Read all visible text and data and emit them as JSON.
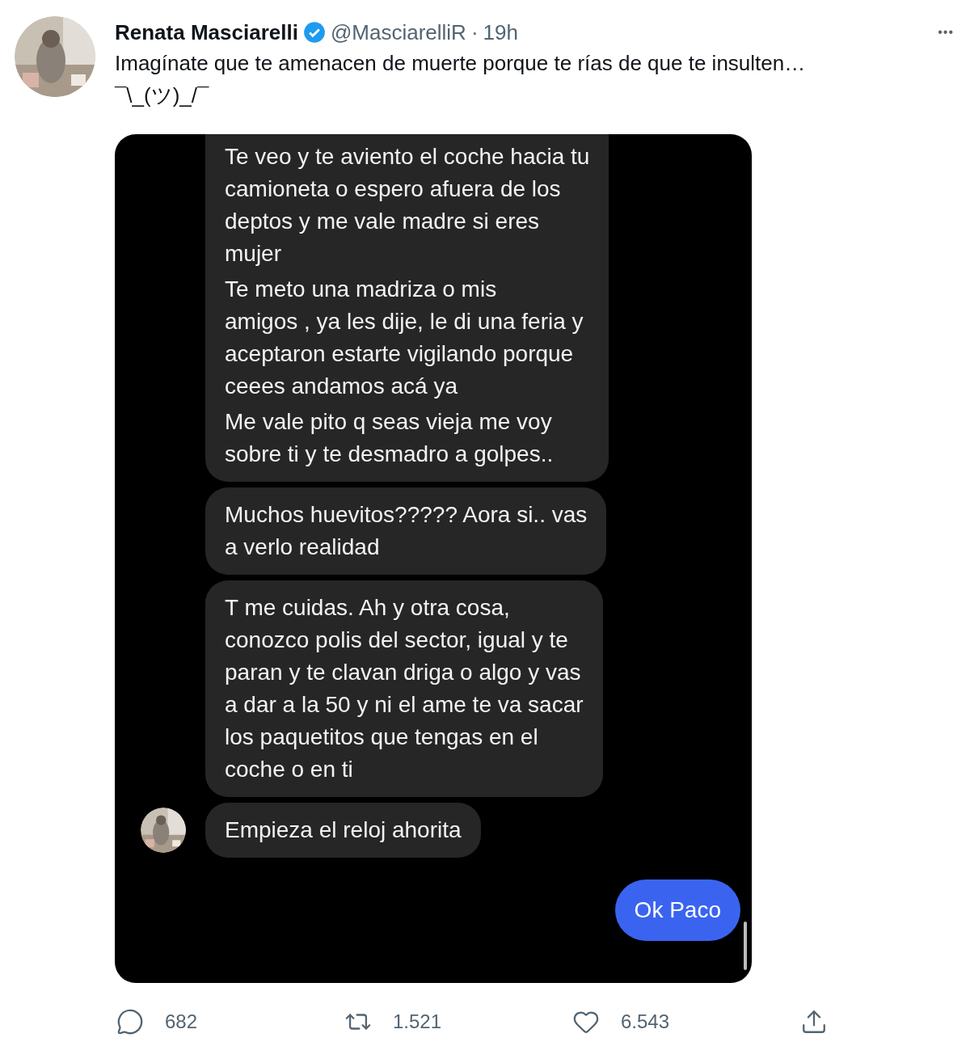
{
  "tweet": {
    "author": {
      "name": "Renata Masciarelli",
      "verified": true,
      "handle": "@MasciarelliR",
      "separator": "·",
      "time": "19h"
    },
    "more": "•••",
    "text": [
      "Imagínate que te amenacen de muerte porque te rías de que te insulten…",
      "¯\\_(ツ)_/¯"
    ],
    "chat": {
      "messages": [
        {
          "kind": "received",
          "cut_top": true,
          "paragraphs": [
            [
              "Te veo y te aviento el coche hacia tu",
              "camioneta o espero afuera de los",
              "deptos y me vale madre si eres",
              "mujer"
            ],
            [
              "Te meto una madriza o mis",
              "amigos  , ya les dije, le di una feria y",
              "aceptaron estarte vigilando porque",
              "ceees andamos acá ya"
            ],
            [
              "Me vale pito q seas vieja me voy",
              "sobre ti y te desmadro a golpes.."
            ]
          ]
        },
        {
          "kind": "received",
          "paragraphs": [
            [
              "Muchos huevitos????? Aora si.. vas",
              "a verlo realidad"
            ]
          ]
        },
        {
          "kind": "received",
          "paragraphs": [
            [
              "T me cuidas. Ah y otra cosa,",
              "conozco polis del sector, igual y te",
              "paran y te clavan driga o algo y vas",
              "a dar a la 50 y ni el ame te va sacar",
              "los paquetitos que tengas en el",
              "coche o en ti"
            ]
          ]
        },
        {
          "kind": "received",
          "avatar": true,
          "paragraphs": [
            [
              "Empieza el reloj ahorita"
            ]
          ]
        },
        {
          "kind": "sent",
          "paragraphs": [
            [
              "Ok Paco"
            ]
          ]
        }
      ]
    },
    "actions": [
      {
        "kind": "reply",
        "count": "682"
      },
      {
        "kind": "retweet",
        "count": "1.521"
      },
      {
        "kind": "like",
        "count": "6.543"
      },
      {
        "kind": "share"
      }
    ]
  }
}
